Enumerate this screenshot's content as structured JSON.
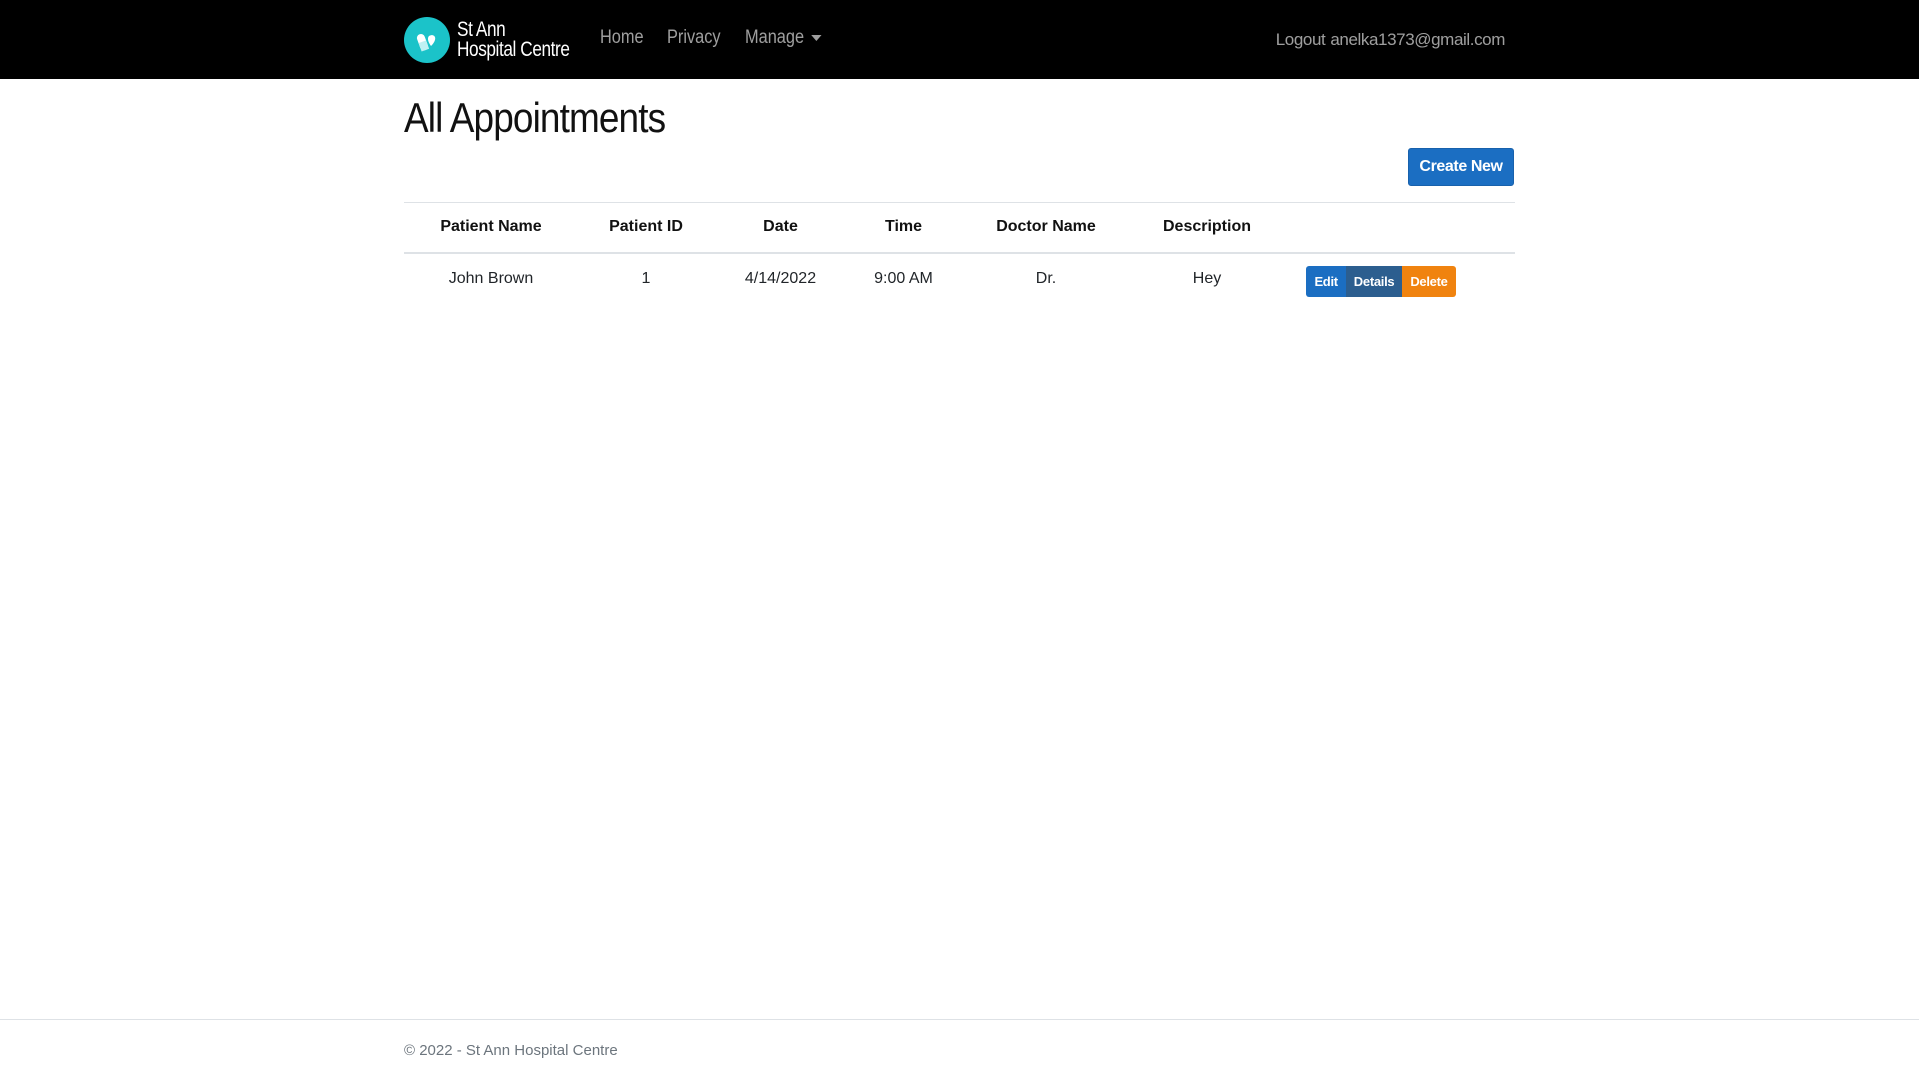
{
  "navbar": {
    "brand_line1": "St Ann",
    "brand_line2": "Hospital Centre",
    "brand_color": "#1bc3c9",
    "links": [
      {
        "label": "Home"
      },
      {
        "label": "Privacy"
      },
      {
        "label": "Manage"
      }
    ],
    "logout_label": "Logout",
    "user_email": "anelka1373@gmail.com"
  },
  "main": {
    "title": "All Appointments",
    "create_label": "Create New",
    "table": {
      "headers": [
        "Patient Name",
        "Patient ID",
        "Date",
        "Time",
        "Doctor Name",
        "Description"
      ],
      "rows": [
        {
          "patient_name": "John Brown",
          "patient_id": "1",
          "date": "4/14/2022",
          "time": "9:00 AM",
          "doctor_name": "Dr.",
          "description": "Hey",
          "actions": {
            "edit": "Edit",
            "details": "Details",
            "delete": "Delete"
          }
        }
      ]
    }
  },
  "footer": {
    "text": "© 2022 - St Ann Hospital Centre"
  },
  "colors": {
    "primary": "#1b6ec2",
    "details": "#2c5e8f",
    "delete": "#f0830f",
    "navbar_bg": "#000000"
  }
}
